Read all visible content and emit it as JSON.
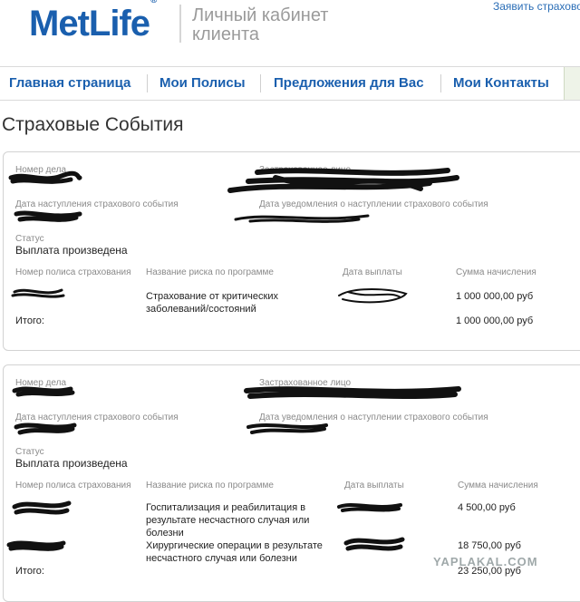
{
  "header": {
    "logo_text": "MetLife",
    "logo_mark": "®",
    "cabinet_title": "Личный кабинет клиента",
    "top_link": "Заявить страхово"
  },
  "nav": {
    "items": [
      {
        "label": "Главная страница"
      },
      {
        "label": "Мои Полисы"
      },
      {
        "label": "Предложения для Вас"
      },
      {
        "label": "Мои Контакты"
      }
    ]
  },
  "page_title": "Страховые События",
  "labels": {
    "case_number": "Номер дела",
    "insured_person": "Застрахованное лицо",
    "event_date": "Дата наступления страхового события",
    "notice_date": "Дата уведомления о наступлении страхового события",
    "status": "Статус",
    "policy_number": "Номер полиса страхования",
    "risk_name": "Название риска по программе",
    "payment_date": "Дата выплаты",
    "amount": "Сумма начисления",
    "total": "Итого:"
  },
  "cards": [
    {
      "status": "Выплата произведена",
      "rows": [
        {
          "risk": "Страхование от критических заболеваний/состояний",
          "amount": "1 000 000,00 руб"
        }
      ],
      "total": "1 000 000,00 руб"
    },
    {
      "status": "Выплата произведена",
      "rows": [
        {
          "risk": "Госпитализация и реабилитация в результате несчастного случая или болезни",
          "amount": "4 500,00 руб"
        },
        {
          "risk": "Хирургические операции в результате несчастного случая или болезни",
          "amount": "18 750,00 руб"
        }
      ],
      "total": "23 250,00 руб"
    }
  ],
  "watermark": "YAPLAKAL.COM",
  "colors": {
    "brand": "#1a5fae",
    "label": "#8a8a8a",
    "redaction": "#111111"
  }
}
